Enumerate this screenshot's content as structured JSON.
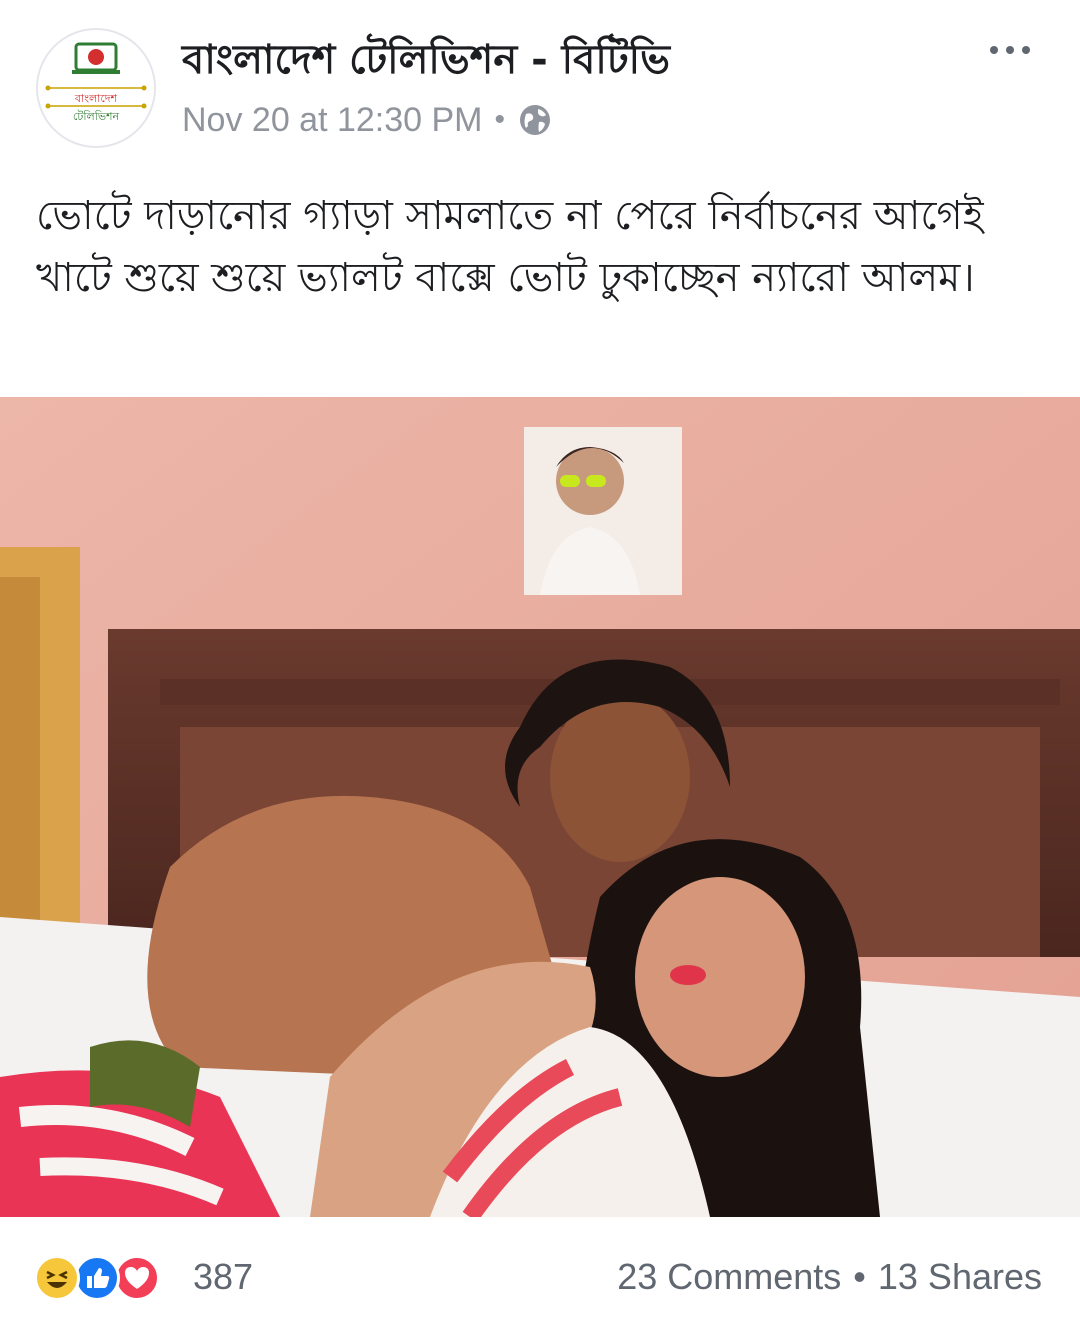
{
  "header": {
    "page_name": "বাংলাদেশ টেলিভিশন - বিটিভি",
    "timestamp": "Nov 20 at 12:30 PM",
    "separator": "•",
    "privacy_icon": "globe-icon",
    "more_icon": "more-dots-icon",
    "avatar_text_line1": "বাংলাদেশ",
    "avatar_text_line2": "টেলিভিশন"
  },
  "post": {
    "text": "ভোটে দাড়ানোর গ্যাড়া সামলাতে না পেরে নির্বাচনের আগেই খাটে শুয়ে শুয়ে ভ্যালট বাক্সে ভোট ঢুকাচ্ছেন ন্যারো আলম।"
  },
  "footer": {
    "reaction_icons": [
      "haha-icon",
      "like-icon",
      "love-icon"
    ],
    "reaction_count": "387",
    "comments": "23 Comments",
    "separator": "•",
    "shares": "13 Shares"
  },
  "colors": {
    "text_primary": "#1c1e21",
    "text_secondary": "#90949c",
    "like_blue": "#1877f2",
    "love_red": "#f33e58",
    "haha_yellow": "#f7c73b",
    "logo_green": "#2e7d32",
    "logo_red": "#d32f2f"
  }
}
